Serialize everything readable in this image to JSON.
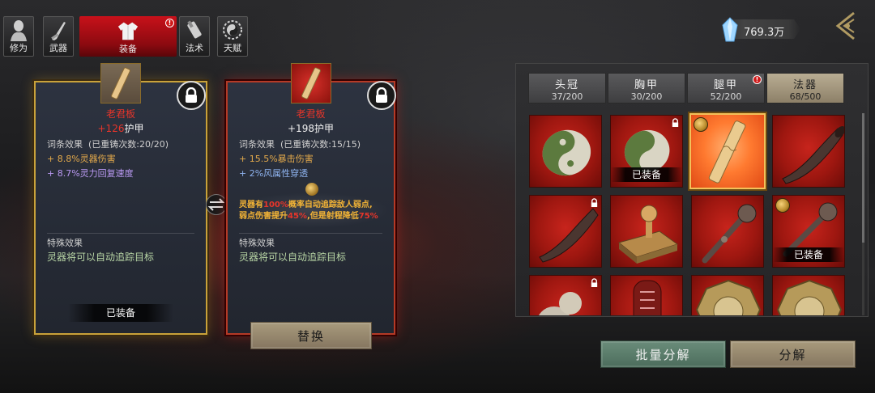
{
  "top_tabs": [
    {
      "label": "修为",
      "icon": "character-silhouette-icon"
    },
    {
      "label": "武器",
      "icon": "sword-icon"
    },
    {
      "label": "装备",
      "icon": "robe-icon",
      "active": true,
      "alert": "!"
    },
    {
      "label": "法术",
      "icon": "scroll-icon"
    },
    {
      "label": "天赋",
      "icon": "yin-yang-icon"
    }
  ],
  "currency": {
    "value": "769.3万",
    "icon": "crystal-icon"
  },
  "equipped_card": {
    "name": "老君板",
    "armor_value": "+126",
    "armor_label": "护甲",
    "affix_header": "词条效果",
    "affix_count": "(已重铸次数:20/20)",
    "affixes": [
      "+ 8.8%灵器伤害",
      "+ 8.7%灵力回复速度"
    ],
    "special_header": "特殊效果",
    "special_text": "灵器将可以自动追踪目标",
    "status": "已装备"
  },
  "candidate_card": {
    "name": "老君板",
    "armor_value": "+198",
    "armor_label": "护甲",
    "affix_header": "词条效果",
    "affix_count": "(已重铸次数:15/15)",
    "affixes": [
      "+ 15.5%暴击伤害",
      "+ 2%风属性穿透"
    ],
    "gem_effect_line1_a": "灵器有",
    "gem_effect_line1_b": "100%",
    "gem_effect_line1_c": "概率自动追踪敌人弱点,",
    "gem_effect_line2_a": "弱点伤害提升",
    "gem_effect_line2_b": "45%",
    "gem_effect_line2_c": ",但是射程降低",
    "gem_effect_line2_d": "75%",
    "special_header": "特殊效果",
    "special_text": "灵器将可以自动追踪目标"
  },
  "buttons": {
    "replace": "替换",
    "batch_dismantle": "批量分解",
    "dismantle": "分解"
  },
  "categories": [
    {
      "name": "头冠",
      "count": "37/200"
    },
    {
      "name": "胸甲",
      "count": "30/200"
    },
    {
      "name": "腿甲",
      "count": "52/200",
      "alert": "!"
    },
    {
      "name": "法器",
      "count": "68/500",
      "active": true
    }
  ],
  "inventory": [
    {
      "item": "yin-yang-disc",
      "badge": ""
    },
    {
      "item": "yin-yang-disc",
      "badge": "已装备",
      "locked": true
    },
    {
      "item": "wooden-board",
      "badge": "",
      "selected": true,
      "gem": true
    },
    {
      "item": "horn",
      "badge": ""
    },
    {
      "item": "horn",
      "badge": "",
      "locked": true
    },
    {
      "item": "stamp",
      "badge": ""
    },
    {
      "item": "ruyi-scepter",
      "badge": ""
    },
    {
      "item": "ruyi-scepter",
      "badge": "已装备",
      "gem": true
    },
    {
      "item": "gourd",
      "badge": "",
      "locked": true
    },
    {
      "item": "talisman-tablet",
      "badge": ""
    },
    {
      "item": "bagua-mirror",
      "badge": ""
    },
    {
      "item": "bagua-mirror",
      "badge": ""
    }
  ],
  "colors": {
    "active_tab": "#b3101a",
    "highlight_red": "#e8352a",
    "affix_gold": "#e3a94b",
    "affix_purple": "#b999f2",
    "affix_blue": "#8fb4f0",
    "special_green": "#b9d7a6",
    "gem_text": "#f3b436"
  }
}
